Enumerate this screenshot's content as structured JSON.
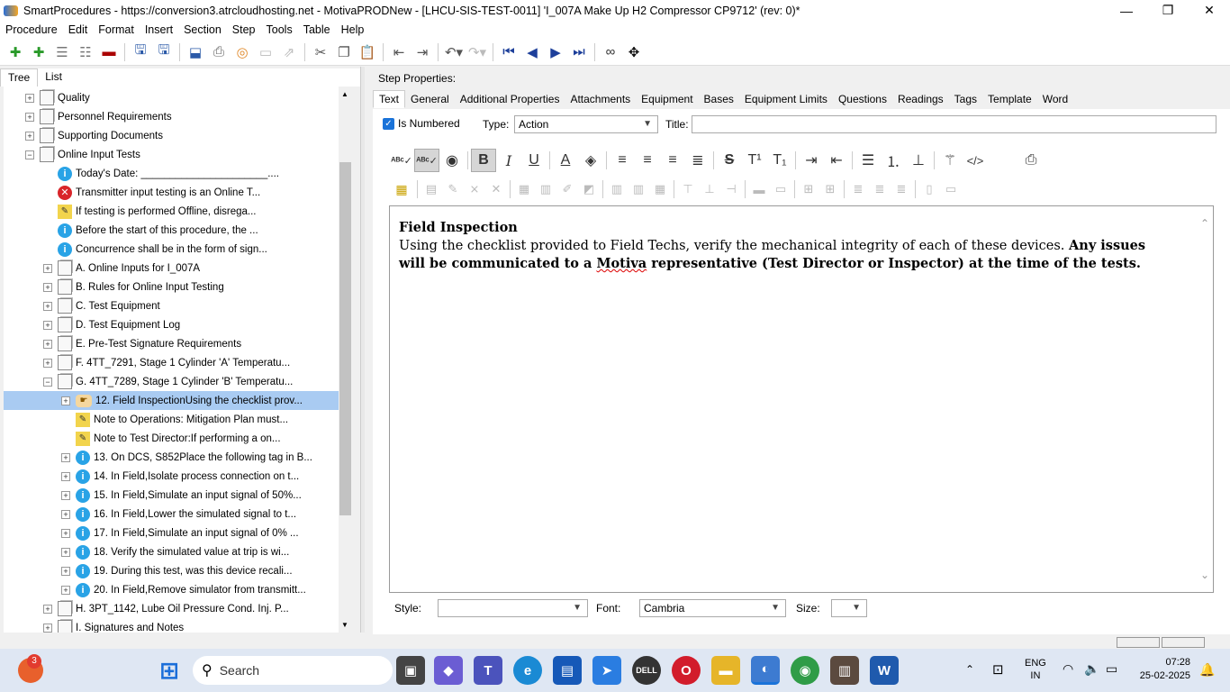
{
  "window": {
    "title": "SmartProcedures - https://conversion3.atrcloudhosting.net - MotivaPRODNew - [LHCU-SIS-TEST-0011] 'I_007A Make Up H2 Compressor CP9712' (rev: 0)*",
    "minimize": "—",
    "maximize": "❐",
    "close": "✕"
  },
  "menu": [
    "Procedure",
    "Edit",
    "Format",
    "Insert",
    "Section",
    "Step",
    "Tools",
    "Table",
    "Help"
  ],
  "left_tabs": [
    "Tree",
    "List"
  ],
  "tree": [
    {
      "label": "Quality",
      "icon": "doc",
      "exp": "+",
      "indent": 0
    },
    {
      "label": "Personnel Requirements",
      "icon": "doc",
      "exp": "+",
      "indent": 0
    },
    {
      "label": "Supporting Documents",
      "icon": "doc",
      "exp": "+",
      "indent": 0
    },
    {
      "label": "Online Input Tests",
      "icon": "doc",
      "exp": "−",
      "indent": 0
    },
    {
      "label": "Today's Date: ______________________....",
      "icon": "info",
      "exp": "",
      "indent": 1
    },
    {
      "label": "Transmitter input testing is an Online T...",
      "icon": "err",
      "exp": "",
      "indent": 1
    },
    {
      "label": "If testing is performed Offline, disrega...",
      "icon": "note",
      "exp": "",
      "indent": 1
    },
    {
      "label": "Before the start of this procedure, the ...",
      "icon": "info",
      "exp": "",
      "indent": 1
    },
    {
      "label": "Concurrence shall be in the form of sign...",
      "icon": "info",
      "exp": "",
      "indent": 1
    },
    {
      "label": "A. Online Inputs for I_007A",
      "icon": "doc",
      "exp": "+",
      "indent": 1
    },
    {
      "label": "B. Rules for Online Input Testing",
      "icon": "doc",
      "exp": "+",
      "indent": 1
    },
    {
      "label": "C. Test Equipment",
      "icon": "doc",
      "exp": "+",
      "indent": 1
    },
    {
      "label": "D. Test Equipment Log",
      "icon": "doc",
      "exp": "+",
      "indent": 1
    },
    {
      "label": "E. Pre-Test Signature Requirements",
      "icon": "doc",
      "exp": "+",
      "indent": 1
    },
    {
      "label": "F. 4TT_7291, Stage 1 Cylinder 'A' Temperatu...",
      "icon": "doc",
      "exp": "+",
      "indent": 1
    },
    {
      "label": "G. 4TT_7289, Stage 1 Cylinder 'B' Temperatu...",
      "icon": "doc",
      "exp": "−",
      "indent": 1
    },
    {
      "label": "12. Field InspectionUsing the checklist prov...",
      "icon": "hand",
      "exp": "+",
      "indent": 2,
      "selected": true
    },
    {
      "label": "Note to Operations: Mitigation Plan must...",
      "icon": "note",
      "exp": "",
      "indent": 2
    },
    {
      "label": "Note to Test Director:If performing a on...",
      "icon": "note",
      "exp": "",
      "indent": 2
    },
    {
      "label": "13. On DCS, S852Place the following tag in B...",
      "icon": "info",
      "exp": "+",
      "indent": 2
    },
    {
      "label": "14. In Field,Isolate process connection on t...",
      "icon": "info",
      "exp": "+",
      "indent": 2
    },
    {
      "label": "15. In Field,Simulate an input signal of 50%...",
      "icon": "info",
      "exp": "+",
      "indent": 2
    },
    {
      "label": "16. In Field,Lower the simulated signal to t...",
      "icon": "info",
      "exp": "+",
      "indent": 2
    },
    {
      "label": "17. In Field,Simulate an input signal of 0% ...",
      "icon": "info",
      "exp": "+",
      "indent": 2
    },
    {
      "label": "18. Verify the simulated value at trip is wi...",
      "icon": "info",
      "exp": "+",
      "indent": 2
    },
    {
      "label": "19. During this test, was this device recali...",
      "icon": "info",
      "exp": "+",
      "indent": 2
    },
    {
      "label": "20. In Field,Remove simulator from transmitt...",
      "icon": "info",
      "exp": "+",
      "indent": 2
    },
    {
      "label": "H. 3PT_1142, Lube Oil Pressure Cond. Inj. P...",
      "icon": "doc",
      "exp": "+",
      "indent": 1
    },
    {
      "label": "I. Signatures and Notes",
      "icon": "doc",
      "exp": "+",
      "indent": 1
    }
  ],
  "step_props_label": "Step Properties:",
  "right_tabs": [
    "Text",
    "General",
    "Additional Properties",
    "Attachments",
    "Equipment",
    "Bases",
    "Equipment Limits",
    "Questions",
    "Readings",
    "Tags",
    "Template",
    "Word"
  ],
  "props": {
    "is_numbered_label": "Is Numbered",
    "type_label": "Type:",
    "type_value": "Action",
    "title_label": "Title:",
    "title_value": ""
  },
  "editor": {
    "heading": "Field Inspection",
    "body_plain": "Using the checklist provided to Field Techs, verify the mechanical integrity of each of these devices. ",
    "body_bold_1": "Any issues will be communicated to a ",
    "body_bold_underlined": "Motiva",
    "body_bold_2": " representative (Test Director or Inspector) at the time of the tests."
  },
  "bottom": {
    "style_label": "Style:",
    "style_value": "",
    "font_label": "Font:",
    "font_value": "Cambria",
    "size_label": "Size:",
    "size_value": ""
  },
  "taskbar": {
    "search_placeholder": "Search",
    "badge_count": "3",
    "lang_line1": "ENG",
    "lang_line2": "IN",
    "time": "07:28",
    "date": "25-02-2025"
  },
  "colors": {
    "selection": "#a9cbf2",
    "info": "#29a3e6",
    "error": "#d9252a",
    "accent": "#1a73d9"
  }
}
